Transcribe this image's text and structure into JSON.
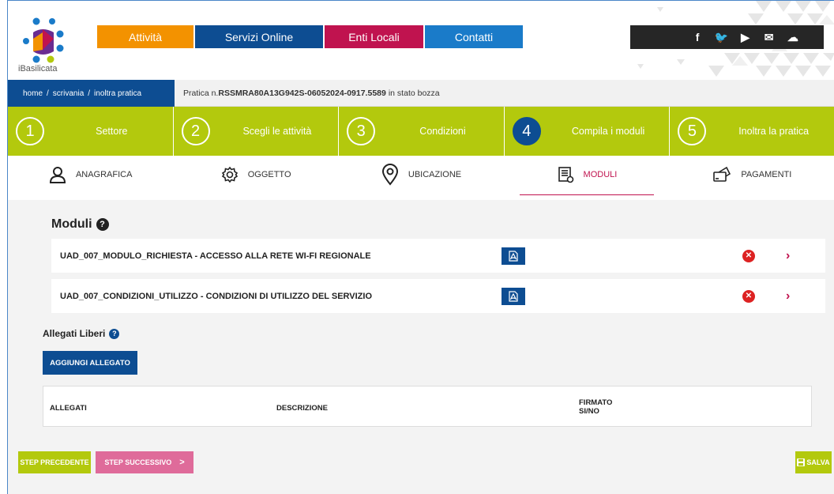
{
  "brand": {
    "name": "iBasilicata"
  },
  "topnav": [
    {
      "label": "Attività",
      "color": "#f39200",
      "width": 122
    },
    {
      "label": "Servizi Online",
      "color": "#0d4d92",
      "width": 162
    },
    {
      "label": "Enti Locali",
      "color": "#c0134f",
      "width": 125
    },
    {
      "label": "Contatti",
      "color": "#1a7bc9",
      "width": 124
    }
  ],
  "social": [
    {
      "icon": "facebook-icon",
      "glyph": "f"
    },
    {
      "icon": "twitter-icon",
      "glyph": "🐦"
    },
    {
      "icon": "youtube-icon",
      "glyph": "▶"
    },
    {
      "icon": "email-icon",
      "glyph": "✉"
    },
    {
      "icon": "cloud-icon",
      "glyph": "☁"
    }
  ],
  "breadcrumb": {
    "home": "home",
    "sep": "/",
    "scrivania": "scrivania",
    "current": "inoltra pratica",
    "pratica_prefix": "Pratica n.",
    "pratica_number": "RSSMRA80A13G942S-06052024-0917.5589",
    "pratica_suffix": "in stato bozza"
  },
  "steps": [
    {
      "num": "1",
      "label": "Settore",
      "active": false
    },
    {
      "num": "2",
      "label": "Scegli le attività",
      "active": false
    },
    {
      "num": "3",
      "label": "Condizioni",
      "active": false
    },
    {
      "num": "4",
      "label": "Compila i moduli",
      "active": true
    },
    {
      "num": "5",
      "label": "Inoltra la pratica",
      "active": false
    }
  ],
  "subtabs": [
    {
      "label": "ANAGRAFICA",
      "icon": "user-icon",
      "active": false
    },
    {
      "label": "OGGETTO",
      "icon": "gear-icon",
      "active": false
    },
    {
      "label": "UBICAZIONE",
      "icon": "location-pin-icon",
      "active": false
    },
    {
      "label": "MODULI",
      "icon": "document-icon",
      "active": true
    },
    {
      "label": "PAGAMENTI",
      "icon": "payment-card-icon",
      "active": false
    }
  ],
  "moduli": {
    "title": "Moduli",
    "rows": [
      {
        "label": "UAD_007_MODULO_RICHIESTA - ACCESSO ALLA RETE WI-FI REGIONALE"
      },
      {
        "label": "UAD_007_CONDIZIONI_UTILIZZO - CONDIZIONI DI UTILIZZO DEL SERVIZIO"
      }
    ]
  },
  "allegati": {
    "title": "Allegati Liberi",
    "add_label": "AGGIUNGI ALLEGATO",
    "columns": {
      "allegati": "ALLEGATI",
      "descrizione": "DESCRIZIONE",
      "firmato": "FIRMATO",
      "sino": "SI/NO"
    }
  },
  "footer": {
    "prev_label": "STEP PRECEDENTE",
    "next_label": "STEP SUCCESSIVO",
    "next_arrow": ">",
    "save_label": "SALVA"
  },
  "colors": {
    "primary_blue": "#0d4d92",
    "lime": "#b3c90d",
    "magenta": "#c0134f",
    "pink": "#df6b9a",
    "error": "#dd2222"
  }
}
